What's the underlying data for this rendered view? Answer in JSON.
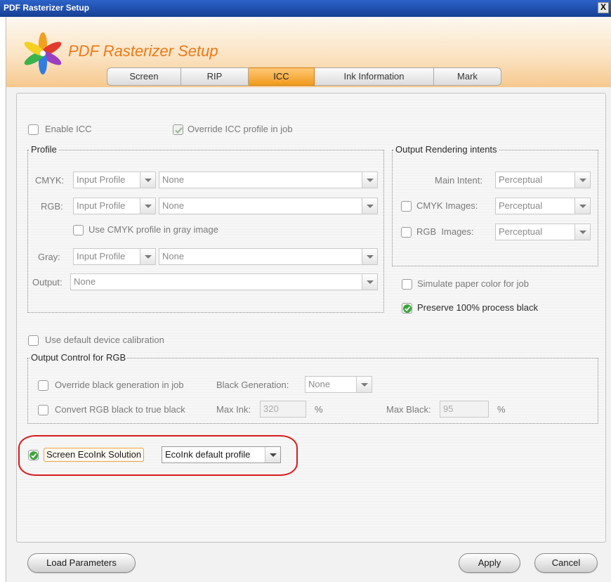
{
  "window": {
    "title": "PDF Rasterizer Setup",
    "close_label": "X"
  },
  "header": {
    "app_title": "PDF Rasterizer Setup"
  },
  "tabs": [
    {
      "label": "Screen"
    },
    {
      "label": "RIP"
    },
    {
      "label": "ICC",
      "active": true
    },
    {
      "label": "Ink Information"
    },
    {
      "label": "Mark"
    }
  ],
  "icc": {
    "enable_icc": {
      "label": "Enable ICC",
      "checked": false
    },
    "override_profile": {
      "label": "Override ICC profile in job",
      "checked": true
    }
  },
  "profile": {
    "title": "Profile",
    "cmyk": {
      "label": "CMYK:",
      "source": "Input Profile",
      "value": "None"
    },
    "rgb": {
      "label": "RGB:",
      "source": "Input Profile",
      "value": "None"
    },
    "use_cmyk_gray": {
      "label": "Use CMYK profile in gray image",
      "checked": false
    },
    "gray": {
      "label": "Gray:",
      "source": "Input Profile",
      "value": "None"
    },
    "output": {
      "label": "Output:",
      "value": "None"
    }
  },
  "intents": {
    "title": "Output Rendering intents",
    "main": {
      "label": "Main Intent:",
      "value": "Perceptual"
    },
    "cmyk_images": {
      "label": "CMYK Images:",
      "value": "Perceptual",
      "checked": false
    },
    "rgb_images": {
      "label": "RGB  Images:",
      "value": "Perceptual",
      "checked": false
    }
  },
  "simulate_paper": {
    "label": "Simulate paper color for job",
    "checked": false
  },
  "preserve_black": {
    "label": "Preserve 100% process black",
    "checked": true
  },
  "default_calibration": {
    "label": "Use default device calibration",
    "checked": false
  },
  "rgb_control": {
    "title": "Output Control for RGB",
    "override_black": {
      "label": "Override black generation in job",
      "checked": false
    },
    "black_generation": {
      "label": "Black Generation:",
      "value": "None"
    },
    "convert_black": {
      "label": "Convert RGB black to true black",
      "checked": false
    },
    "max_ink": {
      "label": "Max Ink:",
      "value": "320",
      "unit": "%"
    },
    "max_black": {
      "label": "Max Black:",
      "value": "95",
      "unit": "%"
    }
  },
  "ecoink": {
    "label": "Screen EcoInk Solution",
    "checked": true,
    "profile": "EcoInk default profile"
  },
  "buttons": {
    "load": "Load Parameters",
    "apply": "Apply",
    "cancel": "Cancel"
  },
  "colors": {
    "title_bar": "#1f4fb0",
    "accent_orange": "#f09a1d",
    "header_title": "#ea7a1a",
    "highlight_red": "#d81c1c",
    "check_green": "#3aa63a"
  }
}
